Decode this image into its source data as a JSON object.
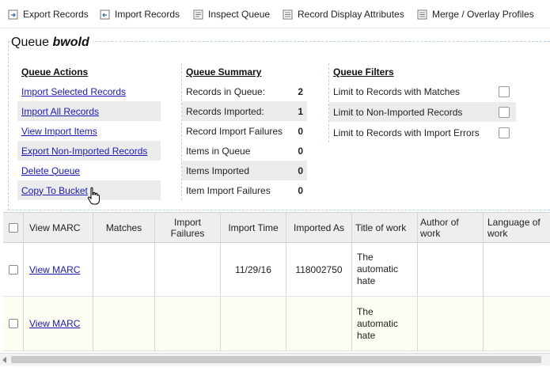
{
  "toolbar": {
    "items": [
      {
        "label": "Export Records",
        "icon": "export-icon"
      },
      {
        "label": "Import Records",
        "icon": "import-icon"
      },
      {
        "label": "Inspect Queue",
        "icon": "inspect-icon"
      },
      {
        "label": "Record Display Attributes",
        "icon": "attributes-icon"
      },
      {
        "label": "Merge / Overlay Profiles",
        "icon": "merge-icon"
      }
    ]
  },
  "queue": {
    "title_prefix": "Queue",
    "name": "bwold"
  },
  "actions": {
    "heading": "Queue Actions",
    "items": [
      "Import Selected Records",
      "Import All Records",
      "View Import Items",
      "Export Non-Imported Records",
      "Delete Queue",
      "Copy To Bucket"
    ]
  },
  "summary": {
    "heading": "Queue Summary",
    "items": [
      {
        "label": "Records in Queue:",
        "value": "2"
      },
      {
        "label": "Records Imported:",
        "value": "1"
      },
      {
        "label": "Record Import Failures",
        "value": "0"
      },
      {
        "label": "Items in Queue",
        "value": "0"
      },
      {
        "label": "Items Imported",
        "value": "0"
      },
      {
        "label": "Item Import Failures",
        "value": "0"
      }
    ]
  },
  "filters": {
    "heading": "Queue Filters",
    "items": [
      {
        "label": "Limit to Records with Matches",
        "checked": false
      },
      {
        "label": "Limit to Non-Imported Records",
        "checked": false
      },
      {
        "label": "Limit to Records with Import Errors",
        "checked": false
      }
    ]
  },
  "grid": {
    "columns": [
      "View MARC",
      "Matches",
      "Import Failures",
      "Import Time",
      "Imported As",
      "Title of work",
      "Author of work",
      "Language of work"
    ],
    "rows": [
      {
        "view": "View MARC",
        "matches": "",
        "failures": "",
        "time": "11/29/16",
        "imported_as": "118002750",
        "title": "The automatic hate",
        "author": "",
        "language": ""
      },
      {
        "view": "View MARC",
        "matches": "",
        "failures": "",
        "time": "",
        "imported_as": "",
        "title": "The automatic hate",
        "author": "",
        "language": ""
      }
    ]
  },
  "colors": {
    "link": "#1a1ab0",
    "shade": "#ececec",
    "dashed_border": "#b8d2ea",
    "alt_row": "#fdfcf2"
  }
}
